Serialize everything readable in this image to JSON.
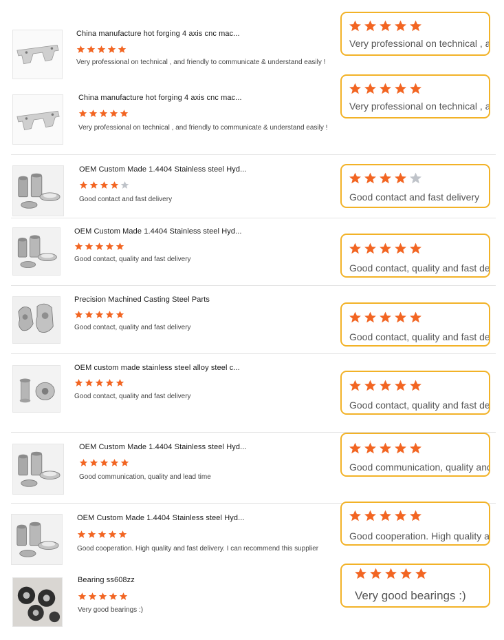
{
  "colors": {
    "star_filled": "#f26522",
    "star_empty": "#bfc3c9",
    "bubble_border": "#f2b227"
  },
  "reviews": [
    {
      "title": "China manufacture hot forging 4 axis cnc mac...",
      "rating": 5,
      "comment": "Very professional on technical , and friendly to communicate & understand easily !",
      "bubble_text": "Very professional on technical , and friendly to communicate & understand easily !",
      "image": "bracket-part-image"
    },
    {
      "title": "China manufacture hot forging 4 axis cnc mac...",
      "rating": 5,
      "comment": "Very professional on technical , and friendly to communicate & understand easily !",
      "bubble_text": "Very professional on technical , and friendly to communicate & understand easily !",
      "image": "bracket-part-image"
    },
    {
      "title": "OEM Custom Made 1.4404 Stainless steel Hyd...",
      "rating": 4,
      "comment": "Good contact and fast delivery",
      "bubble_text": "Good contact and fast delivery",
      "image": "steel-fittings-image"
    },
    {
      "title": "OEM Custom Made 1.4404 Stainless steel Hyd...",
      "rating": 5,
      "comment": "Good contact, quality and fast delivery",
      "bubble_text": "Good contact, quality and fast delivery",
      "image": "steel-fittings-image"
    },
    {
      "title": "Precision Machined Casting Steel Parts",
      "rating": 5,
      "comment": "Good contact, quality and fast delivery",
      "bubble_text": "Good contact, quality and fast delivery",
      "image": "casting-parts-image"
    },
    {
      "title": "OEM custom made stainless steel alloy steel c...",
      "rating": 5,
      "comment": "Good contact, quality and fast delivery",
      "bubble_text": "Good contact, quality and fast delivery",
      "image": "alloy-parts-image"
    },
    {
      "title": "OEM Custom Made 1.4404 Stainless steel Hyd...",
      "rating": 5,
      "comment": "Good communication, quality and lead time",
      "bubble_text": "Good communication, quality and lead time",
      "image": "steel-fittings-image"
    },
    {
      "title": "OEM Custom Made 1.4404 Stainless steel Hyd...",
      "rating": 5,
      "comment": "Good cooperation. High quality and fast delivery. I can recommend this supplier",
      "bubble_text": "Good cooperation. High quality and fast delivery. I can recommend this supplier",
      "image": "steel-fittings-image"
    },
    {
      "title": "Bearing ss608zz",
      "rating": 5,
      "comment": "Very good bearings :)",
      "bubble_text": "Very good bearings :)",
      "image": "bearings-image"
    }
  ]
}
